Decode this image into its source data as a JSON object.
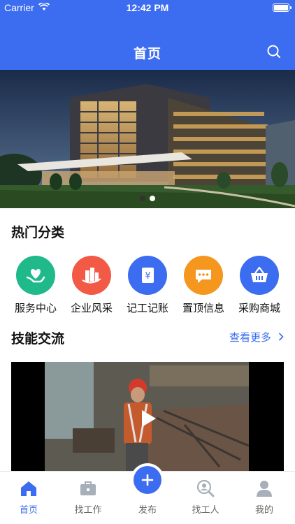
{
  "status_bar": {
    "carrier": "Carrier",
    "time": "12:42 PM"
  },
  "header": {
    "title": "首页",
    "search_icon": "search-icon"
  },
  "banner": {
    "image": "office-building-photo",
    "pages": 2,
    "active_page": 2
  },
  "hot_categories": {
    "title": "热门分类",
    "items": [
      {
        "label": "服务中心",
        "icon": "heart-hand-icon",
        "color": "#1fb98a"
      },
      {
        "label": "企业风采",
        "icon": "buildings-icon",
        "color": "#f25a46"
      },
      {
        "label": "记工记账",
        "icon": "ledger-yen-icon",
        "color": "#3c6df0"
      },
      {
        "label": "置顶信息",
        "icon": "chat-bubble-icon",
        "color": "#f5961f"
      },
      {
        "label": "采购商城",
        "icon": "shopping-basket-icon",
        "color": "#3c6df0"
      }
    ]
  },
  "skills": {
    "title": "技能交流",
    "more_label": "查看更多",
    "video": {
      "thumbnail": "worker-in-factory-photo",
      "play_icon": "play-icon"
    }
  },
  "tabbar": {
    "items": [
      {
        "label": "首页",
        "icon": "home-icon",
        "active": true
      },
      {
        "label": "找工作",
        "icon": "briefcase-icon",
        "active": false
      },
      {
        "label": "发布",
        "icon": "plus-icon",
        "active": false
      },
      {
        "label": "找工人",
        "icon": "find-person-icon",
        "active": false
      },
      {
        "label": "我的",
        "icon": "user-icon",
        "active": false
      }
    ]
  },
  "colors": {
    "primary": "#3c6df0",
    "tab_inactive": "#9aa3ad"
  }
}
